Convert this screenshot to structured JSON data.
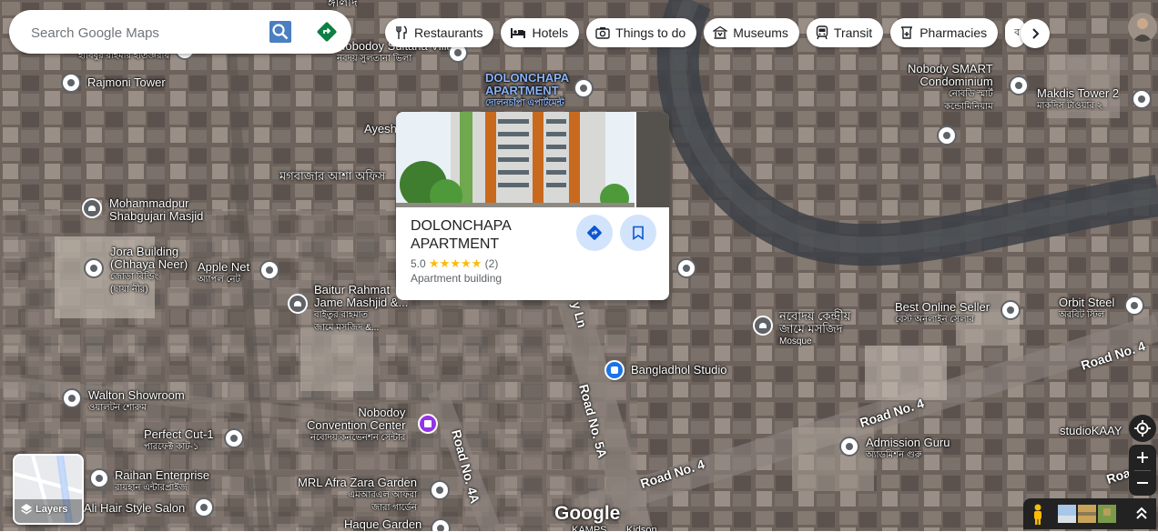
{
  "search": {
    "placeholder": "Search Google Maps"
  },
  "chips": [
    {
      "label": "Restaurants",
      "icon": "restaurant-icon"
    },
    {
      "label": "Hotels",
      "icon": "hotel-icon"
    },
    {
      "label": "Things to do",
      "icon": "camera-icon"
    },
    {
      "label": "Museums",
      "icon": "museum-icon"
    },
    {
      "label": "Transit",
      "icon": "transit-icon"
    },
    {
      "label": "Pharmacies",
      "icon": "pharmacy-icon"
    },
    {
      "label": "ব",
      "icon": ""
    }
  ],
  "place_card": {
    "title": "DOLONCHAPA APARTMENT",
    "rating": "5.0",
    "stars": "★★★★★",
    "reviews": "(2)",
    "type": "Apartment building"
  },
  "labels": {
    "top_partial_bn": "ঙ্গালাদ",
    "sultana_villa": "Nobodoy Sultana Villa",
    "sultana_villa_bn": "নবদয় সুলতানা ভিলা",
    "left_top_bn": "হাবিবুর রহিমার হাতজ্ঞরায়",
    "rajmoni": "Rajmoni Tower",
    "dolonchapa_map": "DOLONCHAPA",
    "dolonchapa_map2": "APARTMENT",
    "dolonchapa_map_bn": "দোলনচাঁপা এপার্টমেন্ট",
    "ayesha": "Ayesh",
    "moghbazar_bn": "মগবাজার আশা অফিস",
    "mohammadpur": "Mohammadpur",
    "shabgujari": "Shabgujari Masjid",
    "jora_building": "Jora Building",
    "chhaya_neer": "(Chhaya Neer)",
    "jora_bn": "জোড়া বিল্ডিং",
    "jora_bn2": "(ছায়া নীর)",
    "apple_net": "Apple Net",
    "apple_net_bn": "অ্যাপল নেট",
    "baitur_rahmat": "Baitur Rahmat",
    "jame_mashjid": "Jame Mashjid &...",
    "baitur_bn": "বাইতুর রাহমাত",
    "baitur_bn2": "জামে মসজিদ &...",
    "nobody_smart": "Nobody SMART",
    "condominium": "Condominium",
    "nobody_smart_bn": "নোবডি স্মার্ট",
    "nobody_smart_bn2": "কন্ডোমিনিয়াম",
    "makdis": "Makdis Tower 2",
    "makdis_bn": "মাকদিস টাওয়ার ২",
    "best_online": "Best Online Seller",
    "best_online_bn": "বেস্ট অনলাইন সেলার",
    "orbit": "Orbit Steel",
    "orbit_bn": "অরবিট স্টিল",
    "mosque_bn": "নবোদয় কেন্দ্রীয়",
    "mosque_bn2": "জামে মসজিদ",
    "mosque": "Mosque",
    "bangladhol": "Bangladhol Studio",
    "walton": "Walton Showroom",
    "walton_bn": "ওয়ালটন শোরুম",
    "nobodoy_cc": "Nobodoy",
    "nobodoy_cc2": "Convention Center",
    "nobodoy_cc_bn": "নবোদয় কনভেনশন সেন্টার",
    "perfect_cut": "Perfect Cut-1",
    "perfect_cut_bn": "পারফেক্ট কাট-১",
    "raihan": "Raihan Enterprise",
    "raihan_bn": "রায়হান এন্টারপ্রাইজ",
    "ali_hair": "Ali Hair Style Salon",
    "mrl_afra": "MRL Afra Zara Garden",
    "mrl_afra_bn": "এমআরএল আফরা",
    "mrl_afra_bn2": "জারা গার্ডেন",
    "haque_garden": "Haque Garden",
    "admission_guru": "Admission Guru",
    "admission_guru_bn": "অ্যাডমিশন গুরু",
    "studio_kaay": "studioKAAY",
    "kamps": "KAMPS",
    "kidson": "Kidson"
  },
  "roads": {
    "ln": "y Ln",
    "road_5a": "Road No. 5A",
    "road_4a": "Road No. 4A",
    "road_4_center": "Road No. 4",
    "road_4_right": "Road No. 4",
    "road_4_bottom": "Road No. 4",
    "road_far_right": "Road"
  },
  "controls": {
    "layers_label": "Layers",
    "google_logo": "Google"
  },
  "colors": {
    "accent": "#1a73e8",
    "directions_teal": "#0b8043",
    "star": "#fbbc04",
    "purple_pin": "#9334e6"
  }
}
